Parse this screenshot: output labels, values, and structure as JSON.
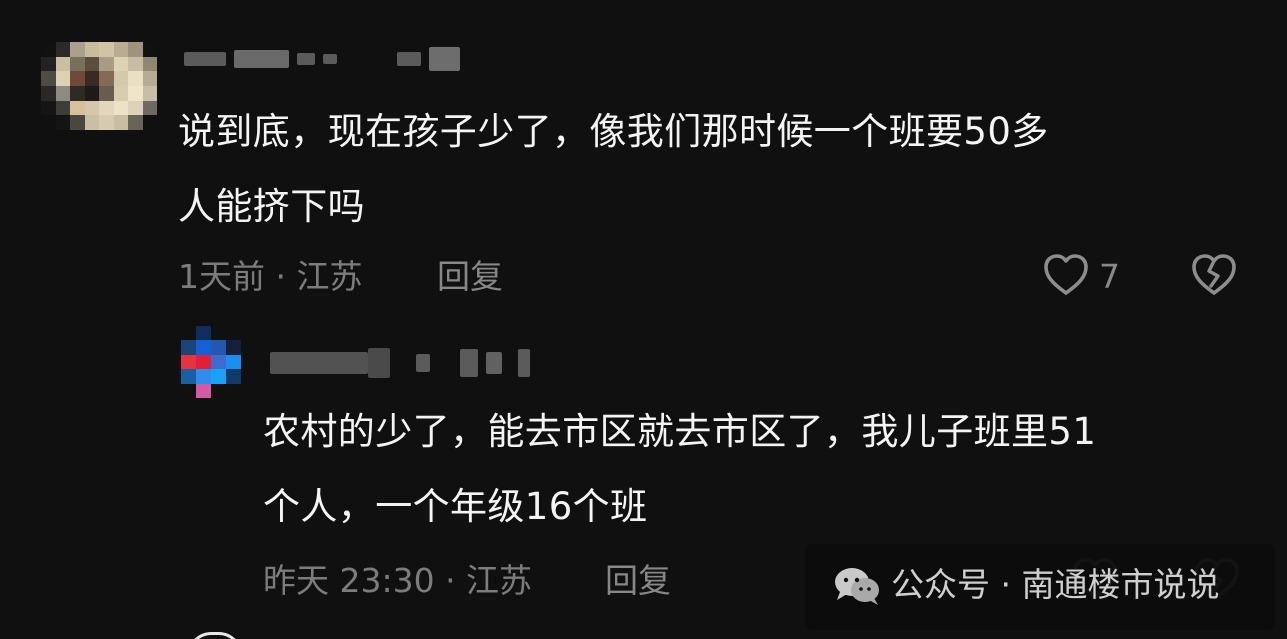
{
  "comments": [
    {
      "text_lines": [
        "说到底，现在孩子少了，像我们那时候一个班要50多",
        "人能挤下吗"
      ],
      "meta": "1天前 · 江苏",
      "reply_label": "回复",
      "like_count": "7",
      "icons": {
        "like": "heart-outline-icon",
        "dislike": "broken-heart-icon"
      }
    },
    {
      "text_lines": [
        "农村的少了，能去市区就去市区了，我儿子班里51",
        "个人，一个年级16个班"
      ],
      "meta": "昨天 23:30 · 江苏",
      "reply_label": "回复",
      "icons": {
        "like": "heart-outline-icon",
        "dislike": "broken-heart-icon"
      }
    }
  ],
  "watermark": {
    "text": "公众号 · 南通楼市说说",
    "icon": "wechat-logo-icon"
  },
  "colors": {
    "background": "#101010",
    "text": "#f4f4f4",
    "meta_text": "#7c7c7c",
    "icon": "#8d8d8d"
  }
}
